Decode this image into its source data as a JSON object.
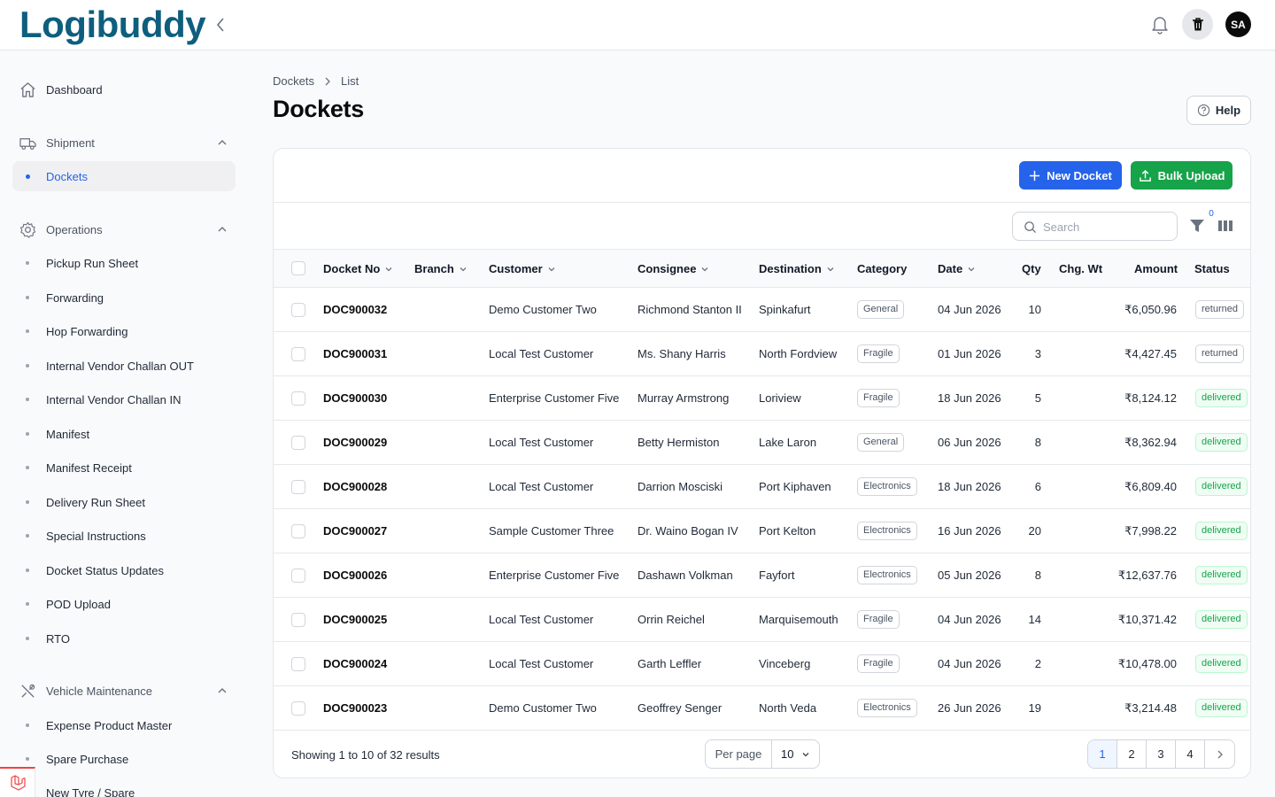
{
  "app": {
    "logo_main": "Logibuddy"
  },
  "header": {
    "avatar_initials": "SA"
  },
  "sidebar": {
    "dashboard": "Dashboard",
    "groups": [
      {
        "label": "Shipment",
        "items": [
          "Dockets"
        ]
      },
      {
        "label": "Operations",
        "items": [
          "Pickup Run Sheet",
          "Forwarding",
          "Hop Forwarding",
          "Internal Vendor Challan OUT",
          "Internal Vendor Challan IN",
          "Manifest",
          "Manifest Receipt",
          "Delivery Run Sheet",
          "Special Instructions",
          "Docket Status Updates",
          "POD Upload",
          "RTO"
        ]
      },
      {
        "label": "Vehicle Maintenance",
        "items": [
          "Expense Product Master",
          "Spare Purchase",
          "New Tyre / Spare"
        ]
      }
    ],
    "active_item": "Dockets"
  },
  "breadcrumb": {
    "first": "Dockets",
    "second": "List"
  },
  "page": {
    "title": "Dockets",
    "help_label": "Help"
  },
  "actions": {
    "new_label": "New Docket",
    "bulk_label": "Bulk Upload"
  },
  "toolbar": {
    "search_placeholder": "Search",
    "filter_count": "0"
  },
  "table": {
    "columns": [
      "Docket No",
      "Branch",
      "Customer",
      "Consignee",
      "Destination",
      "Category",
      "Date",
      "Qty",
      "Chg. Wt",
      "Amount",
      "Status"
    ],
    "rows": [
      {
        "docket": "DOC900032",
        "branch": "",
        "customer": "Demo Customer Two",
        "consignee": "Richmond Stanton II",
        "destination": "Spinkafurt",
        "category": "General",
        "date": "04 Jun 2026",
        "qty": "10",
        "chg": "",
        "amount": "₹6,050.96",
        "status": "returned"
      },
      {
        "docket": "DOC900031",
        "branch": "",
        "customer": "Local Test Customer",
        "consignee": "Ms. Shany Harris",
        "destination": "North Fordview",
        "category": "Fragile",
        "date": "01 Jun 2026",
        "qty": "3",
        "chg": "",
        "amount": "₹4,427.45",
        "status": "returned"
      },
      {
        "docket": "DOC900030",
        "branch": "",
        "customer": "Enterprise Customer Five",
        "consignee": "Murray Armstrong",
        "destination": "Loriview",
        "category": "Fragile",
        "date": "18 Jun 2026",
        "qty": "5",
        "chg": "",
        "amount": "₹8,124.12",
        "status": "delivered"
      },
      {
        "docket": "DOC900029",
        "branch": "",
        "customer": "Local Test Customer",
        "consignee": "Betty Hermiston",
        "destination": "Lake Laron",
        "category": "General",
        "date": "06 Jun 2026",
        "qty": "8",
        "chg": "",
        "amount": "₹8,362.94",
        "status": "delivered"
      },
      {
        "docket": "DOC900028",
        "branch": "",
        "customer": "Local Test Customer",
        "consignee": "Darrion Mosciski",
        "destination": "Port Kiphaven",
        "category": "Electronics",
        "date": "18 Jun 2026",
        "qty": "6",
        "chg": "",
        "amount": "₹6,809.40",
        "status": "delivered"
      },
      {
        "docket": "DOC900027",
        "branch": "",
        "customer": "Sample Customer Three",
        "consignee": "Dr. Waino Bogan IV",
        "destination": "Port Kelton",
        "category": "Electronics",
        "date": "16 Jun 2026",
        "qty": "20",
        "chg": "",
        "amount": "₹7,998.22",
        "status": "delivered"
      },
      {
        "docket": "DOC900026",
        "branch": "",
        "customer": "Enterprise Customer Five",
        "consignee": "Dashawn Volkman",
        "destination": "Fayfort",
        "category": "Electronics",
        "date": "05 Jun 2026",
        "qty": "8",
        "chg": "",
        "amount": "₹12,637.76",
        "status": "delivered"
      },
      {
        "docket": "DOC900025",
        "branch": "",
        "customer": "Local Test Customer",
        "consignee": "Orrin Reichel",
        "destination": "Marquisemouth",
        "category": "Fragile",
        "date": "04 Jun 2026",
        "qty": "14",
        "chg": "",
        "amount": "₹10,371.42",
        "status": "delivered"
      },
      {
        "docket": "DOC900024",
        "branch": "",
        "customer": "Local Test Customer",
        "consignee": "Garth Leffler",
        "destination": "Vinceberg",
        "category": "Fragile",
        "date": "04 Jun 2026",
        "qty": "2",
        "chg": "",
        "amount": "₹10,478.00",
        "status": "delivered"
      },
      {
        "docket": "DOC900023",
        "branch": "",
        "customer": "Demo Customer Two",
        "consignee": "Geoffrey Senger",
        "destination": "North Veda",
        "category": "Electronics",
        "date": "26 Jun 2026",
        "qty": "19",
        "chg": "",
        "amount": "₹3,214.48",
        "status": "delivered"
      }
    ]
  },
  "footer": {
    "showing": "Showing 1 to 10 of 32 results",
    "per_page_label": "Per page",
    "per_page_value": "10",
    "pages": [
      "1",
      "2",
      "3",
      "4"
    ],
    "current_page": "1"
  },
  "colors": {
    "primary": "#2563eb",
    "success": "#16a34a",
    "brand": "#0e5e7e",
    "brand_accent": "#e0245e"
  }
}
